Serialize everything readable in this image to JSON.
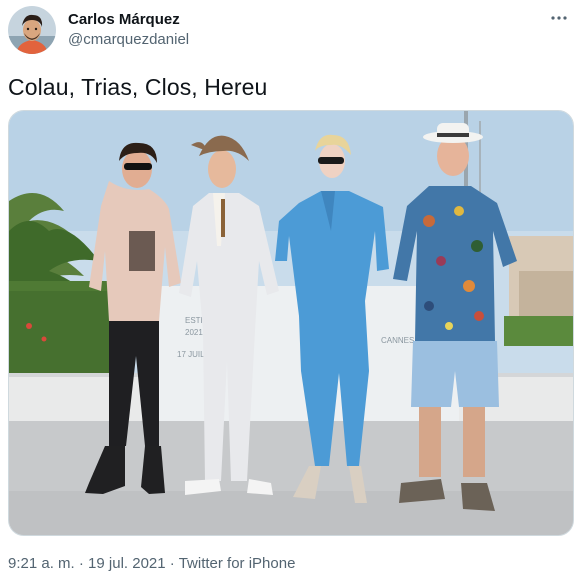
{
  "user": {
    "display_name": "Carlos Márquez",
    "handle": "@cmarquezdaniel"
  },
  "tweet": {
    "text": "Colau, Trias, Clos, Hereu",
    "time": "9:21 a. m.",
    "separator": " · ",
    "date": "19 jul. 2021",
    "source": "Twitter for iPhone"
  },
  "photo": {
    "backdrop_text_1": "ESTIVAL",
    "backdrop_text_2": "CANNES",
    "backdrop_text_3": "17 JUILLET",
    "backdrop_text_4": "2021"
  },
  "icons": {
    "more": "more-horizontal-icon"
  },
  "colors": {
    "text": "#0f1419",
    "secondary": "#536471",
    "border": "#cfd9de",
    "sky": "#c8dbea"
  }
}
